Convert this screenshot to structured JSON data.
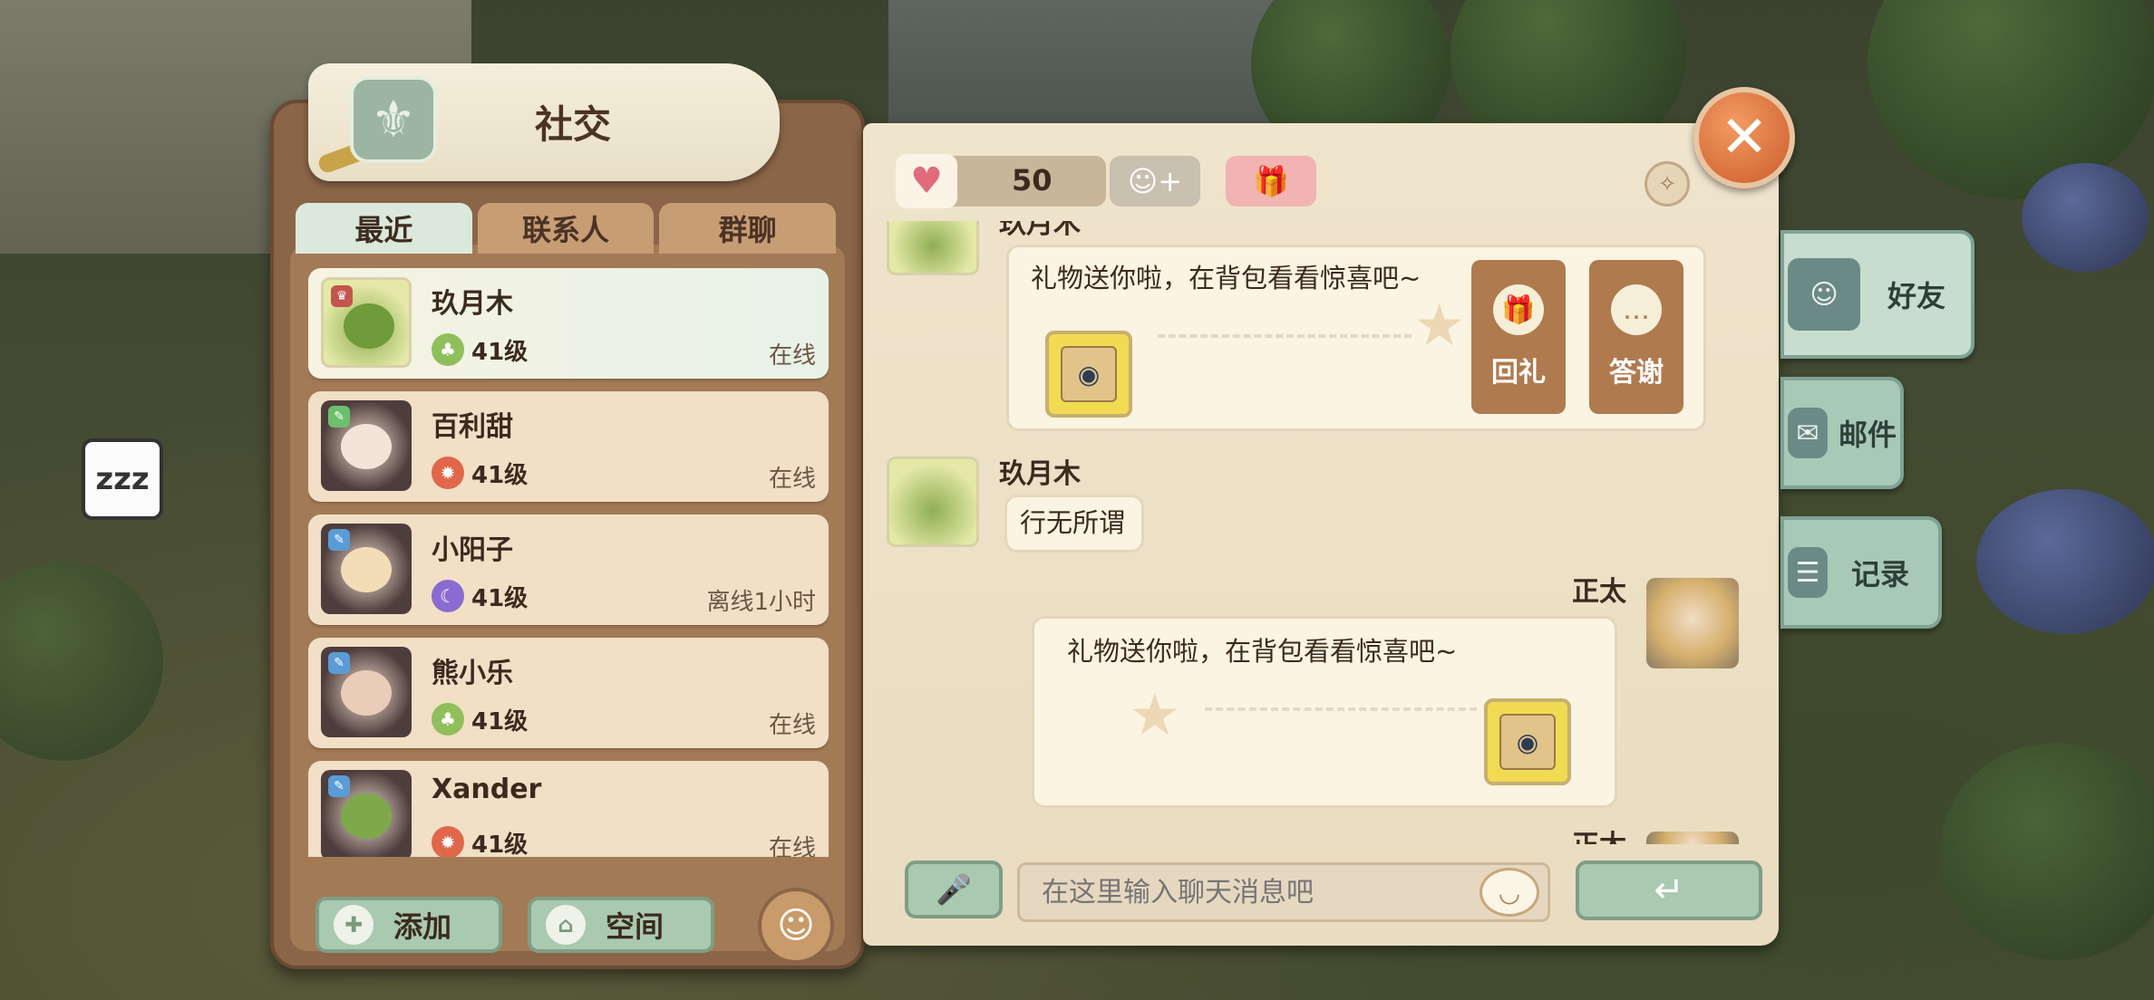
{
  "social": {
    "title": "社交",
    "tabs": [
      {
        "label": "最近",
        "active": true
      },
      {
        "label": "联系人",
        "active": false
      },
      {
        "label": "群聊",
        "active": false
      }
    ],
    "contacts": [
      {
        "name": "玖月木",
        "level": "41级",
        "status": "在线",
        "avatar": "frog-avatar",
        "active": true
      },
      {
        "name": "百利甜",
        "level": "41级",
        "status": "在线",
        "avatar": "cat-girl-avatar",
        "active": false
      },
      {
        "name": "小阳子",
        "level": "41级",
        "status": "离线1小时",
        "avatar": "blonde-cat-avatar",
        "active": false
      },
      {
        "name": "熊小乐",
        "level": "41级",
        "status": "在线",
        "avatar": "dark-hair-cat-avatar",
        "active": false
      },
      {
        "name": "Xander",
        "level": "41级",
        "status": "在线",
        "avatar": "frog-cat-avatar",
        "active": false
      }
    ],
    "add_label": "添加",
    "space_label": "空间"
  },
  "chat": {
    "affinity": "50",
    "top_partial_name": "玖月木",
    "messages": [
      {
        "sender": "玖月木",
        "text": "礼物送你啦，在背包看看惊喜吧~",
        "type": "gift",
        "side": "left"
      },
      {
        "sender": "玖月木",
        "text": "行无所谓",
        "type": "text",
        "side": "left"
      },
      {
        "sender": "正太",
        "text": "礼物送你啦，在背包看看惊喜吧~",
        "type": "gift",
        "side": "right"
      },
      {
        "sender": "正太",
        "text": "",
        "type": "partial",
        "side": "right"
      }
    ],
    "return_gift_label": "回礼",
    "thanks_label": "答谢",
    "input_placeholder": "在这里输入聊天消息吧"
  },
  "side_tabs": [
    {
      "label": "好友",
      "icon": "friend-icon",
      "active": true
    },
    {
      "label": "邮件",
      "icon": "mail-icon",
      "active": false
    },
    {
      "label": "记录",
      "icon": "record-icon",
      "active": false
    }
  ],
  "colors": {
    "panel": "#8a6548",
    "chat_bg": "#efe4cc",
    "accent_green": "#a9c9b0",
    "close": "#cc5c2c"
  }
}
